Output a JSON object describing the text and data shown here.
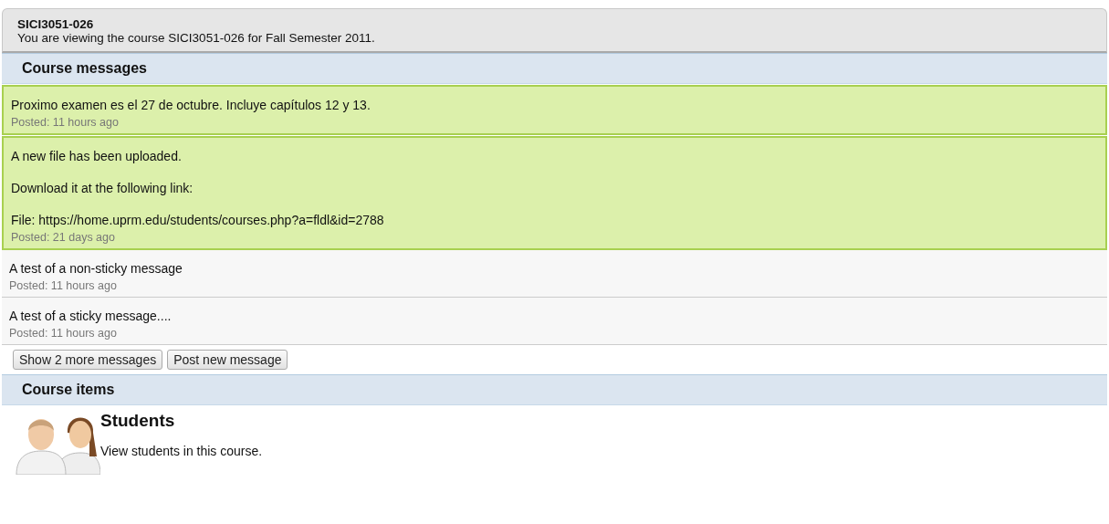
{
  "course": {
    "code": "SICI3051-026",
    "description": "You are viewing the course SICI3051-026 for Fall Semester 2011."
  },
  "messages_section": {
    "title": "Course messages",
    "messages": [
      {
        "sticky": true,
        "paragraphs": [
          "Proximo examen es el 27 de octubre. Incluye capítulos 12 y 13."
        ],
        "posted": "Posted: 11 hours ago"
      },
      {
        "sticky": true,
        "paragraphs": [
          "A new file has been uploaded.",
          "Download it at the following link:",
          "File: https://home.uprm.edu/students/courses.php?a=fldl&id=2788"
        ],
        "posted": "Posted: 21 days ago"
      },
      {
        "sticky": false,
        "paragraphs": [
          "A test of a non-sticky message"
        ],
        "posted": "Posted: 11 hours ago"
      },
      {
        "sticky": false,
        "paragraphs": [
          "A test of a sticky message...."
        ],
        "posted": "Posted: 11 hours ago"
      }
    ],
    "buttons": [
      "Show 2 more messages",
      "Post new message"
    ]
  },
  "items_section": {
    "title": "Course items",
    "items": [
      {
        "title": "Students",
        "description": "View students in this course."
      }
    ]
  }
}
